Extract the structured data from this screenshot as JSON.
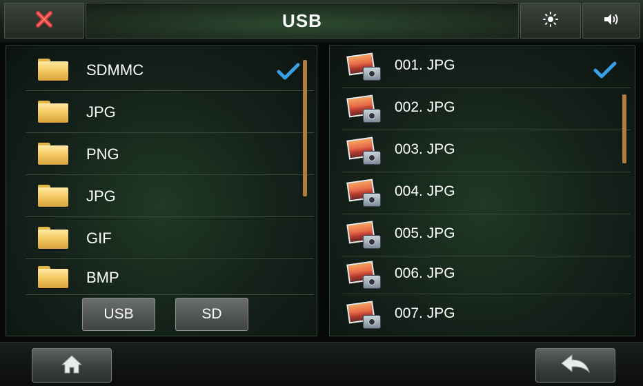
{
  "topbar": {
    "title": "USB",
    "close_icon": "close-icon",
    "brightness_icon": "brightness-icon",
    "volume_icon": "volume-icon"
  },
  "folders": [
    {
      "label": "SDMMC",
      "selected": true
    },
    {
      "label": "JPG",
      "selected": false
    },
    {
      "label": "PNG",
      "selected": false
    },
    {
      "label": "JPG",
      "selected": false
    },
    {
      "label": "GIF",
      "selected": false
    },
    {
      "label": "BMP",
      "selected": false
    }
  ],
  "files": [
    {
      "label": "001. JPG",
      "selected": true
    },
    {
      "label": "002. JPG",
      "selected": false
    },
    {
      "label": "003. JPG",
      "selected": false
    },
    {
      "label": "004. JPG",
      "selected": false
    },
    {
      "label": "005. JPG",
      "selected": false
    },
    {
      "label": "006. JPG",
      "selected": false
    },
    {
      "label": "007. JPG",
      "selected": false
    }
  ],
  "sources": {
    "usb_label": "USB",
    "sd_label": "SD"
  },
  "bottombar": {
    "home_icon": "home-icon",
    "back_icon": "back-arrow-icon"
  },
  "colors": {
    "accent_check": "#3aa0e6",
    "scrollbar": "#b07b3c",
    "close_red": "#e23b3b"
  }
}
